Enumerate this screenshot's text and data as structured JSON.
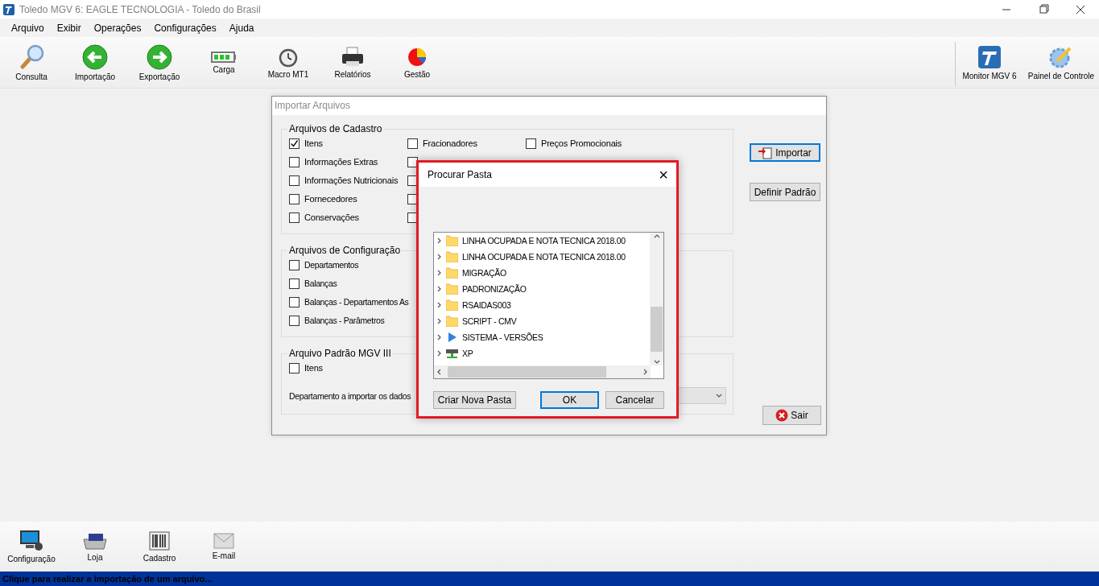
{
  "window": {
    "title": "Toledo MGV 6: EAGLE TECNOLOGIA - Toledo do Brasil"
  },
  "menu": [
    "Arquivo",
    "Exibir",
    "Operações",
    "Configurações",
    "Ajuda"
  ],
  "toolbar": [
    {
      "label": "Consulta"
    },
    {
      "label": "Importação"
    },
    {
      "label": "Exportação"
    },
    {
      "label": "Carga"
    },
    {
      "label": "Macro MT1"
    },
    {
      "label": "Relatórios"
    },
    {
      "label": "Gestão"
    }
  ],
  "toolbar_right": [
    {
      "label": "Monitor MGV 6"
    },
    {
      "label": "Painel de Controle"
    }
  ],
  "import_dialog": {
    "title": "Importar Arquivos",
    "sections": [
      {
        "title": "Arquivos de Cadastro",
        "columns": [
          [
            {
              "label": "Itens",
              "checked": true
            },
            {
              "label": "Informações Extras",
              "checked": false
            },
            {
              "label": "Informações Nutricionais",
              "checked": false
            },
            {
              "label": "Fornecedores",
              "checked": false
            },
            {
              "label": "Conservações",
              "checked": false
            }
          ],
          [
            {
              "label": "Fracionadores",
              "checked": false
            },
            {
              "checked": false
            },
            {
              "checked": false
            },
            {
              "checked": false
            },
            {
              "checked": false
            }
          ],
          [
            {
              "label": "Preços Promocionais",
              "checked": false
            }
          ]
        ]
      },
      {
        "title": "Arquivos de Configuração",
        "columns": [
          [
            {
              "label": "Departamentos",
              "checked": false
            },
            {
              "label": "Balanças",
              "checked": false
            },
            {
              "label": "Balanças - Departamentos As",
              "checked": false
            },
            {
              "label": "Balanças - Parâmetros",
              "checked": false
            }
          ]
        ]
      },
      {
        "title": "Arquivo Padrão MGV III",
        "columns": [
          [
            {
              "label": "Itens",
              "checked": false
            }
          ]
        ],
        "department_label": "Departamento a importar os dados",
        "department_select": {
          "disabled": true
        }
      }
    ],
    "buttons": [
      {
        "label": "Importar",
        "focused": true
      },
      {
        "label": "Definir Padrão",
        "focused": false
      }
    ],
    "exit_button": {
      "label": "Sair"
    }
  },
  "folder_dialog": {
    "title": "Procurar Pasta",
    "close": "×",
    "tree": [
      {
        "label": "LINHA OCUPADA E NOTA TECNICA 2018.00",
        "kind": "folder"
      },
      {
        "label": "LINHA OCUPADA E NOTA TECNICA 2018.00",
        "kind": "folder"
      },
      {
        "label": "MIGRAÇÃO",
        "kind": "folder"
      },
      {
        "label": "PADRONIZAÇÃO",
        "kind": "folder"
      },
      {
        "label": "RSAIDAS003",
        "kind": "folder"
      },
      {
        "label": "SCRIPT - CMV",
        "kind": "folder"
      },
      {
        "label": "SISTEMA - VERSÕES",
        "kind": "shortcut"
      },
      {
        "label": "XP",
        "kind": "drive"
      }
    ],
    "buttons": [
      {
        "label": "Criar Nova Pasta",
        "default": false
      },
      {
        "label": "OK",
        "default": true
      },
      {
        "label": "Cancelar",
        "default": false
      }
    ]
  },
  "bottom_toolbar": [
    {
      "label": "Configuração"
    },
    {
      "label": "Loja"
    },
    {
      "label": "Cadastro"
    },
    {
      "label": "E-mail"
    }
  ],
  "status_bar": "Clique para realizar a importação de um arquivo..."
}
